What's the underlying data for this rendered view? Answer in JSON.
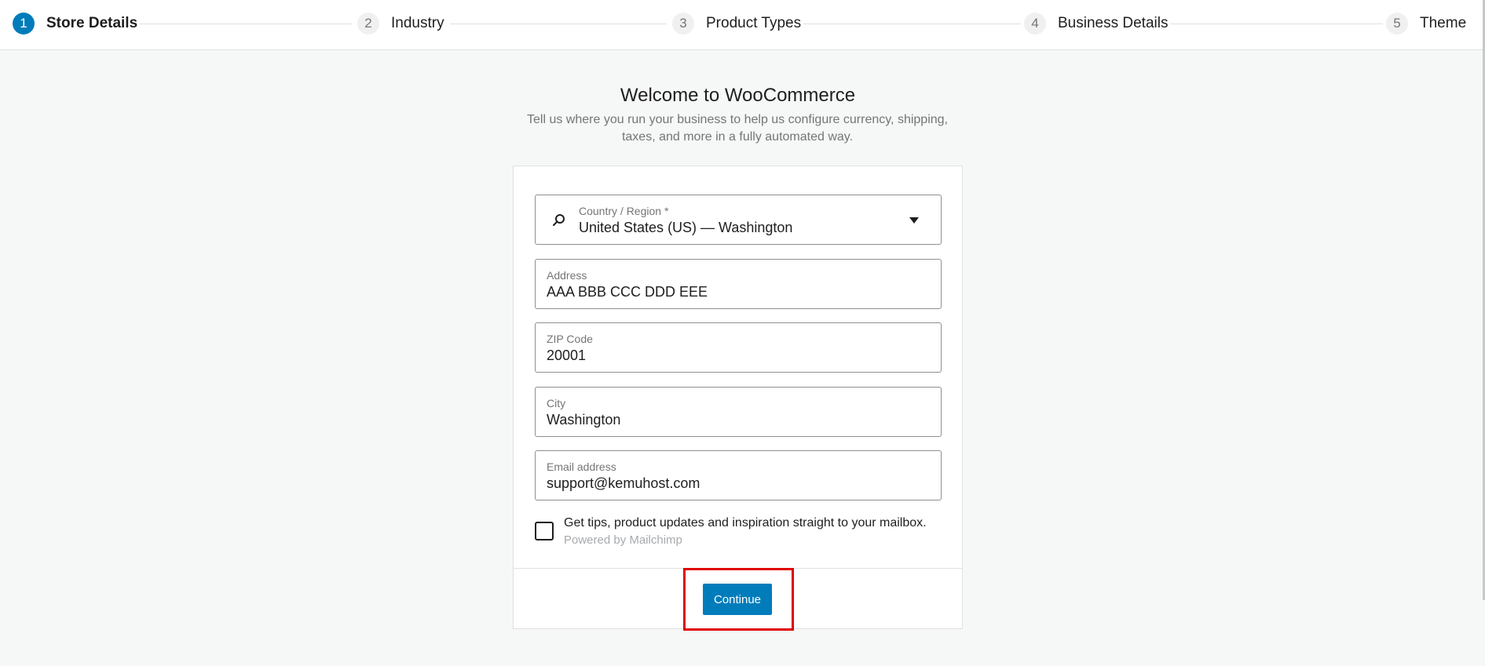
{
  "stepper": {
    "steps": [
      {
        "number": "1",
        "label": "Store Details",
        "active": true
      },
      {
        "number": "2",
        "label": "Industry",
        "active": false
      },
      {
        "number": "3",
        "label": "Product Types",
        "active": false
      },
      {
        "number": "4",
        "label": "Business Details",
        "active": false
      },
      {
        "number": "5",
        "label": "Theme",
        "active": false
      }
    ]
  },
  "header": {
    "title": "Welcome to WooCommerce",
    "subtitle": "Tell us where you run your business to help us configure currency, shipping, taxes, and more in a fully automated way."
  },
  "form": {
    "country": {
      "label": "Country / Region *",
      "value": "United States (US) — Washington",
      "icon": "search-icon"
    },
    "address": {
      "label": "Address",
      "value": "AAA BBB CCC DDD EEE"
    },
    "zip": {
      "label": "ZIP Code",
      "value": "20001"
    },
    "city": {
      "label": "City",
      "value": "Washington"
    },
    "email": {
      "label": "Email address",
      "value": "support@kemuhost.com"
    },
    "newsletter": {
      "label": "Get tips, product updates and inspiration straight to your mailbox.",
      "powered_by": "Powered by Mailchimp",
      "checked": false
    },
    "continue_label": "Continue"
  },
  "colors": {
    "accent": "#007cba",
    "highlight": "#e00000",
    "background": "#f6f7f7"
  }
}
